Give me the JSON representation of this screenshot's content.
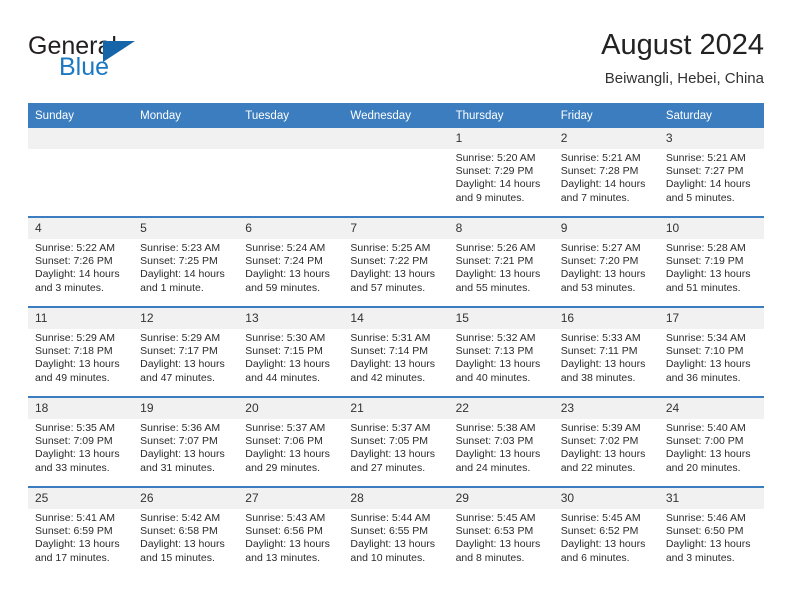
{
  "logo": {
    "word_one": "General",
    "word_two": "Blue",
    "triangle_color": "#1565a8",
    "blue_color": "#1c78c0"
  },
  "header": {
    "title": "August 2024",
    "subtitle": "Beiwangli, Hebei, China"
  },
  "theme": {
    "header_row_bg": "#3b7dbf",
    "date_band_bg": "#f1f1f1",
    "grid_line": "#3b7dbf"
  },
  "weekdays": [
    "Sunday",
    "Monday",
    "Tuesday",
    "Wednesday",
    "Thursday",
    "Friday",
    "Saturday"
  ],
  "weeks": [
    [
      {
        "day": "",
        "empty": true
      },
      {
        "day": "",
        "empty": true
      },
      {
        "day": "",
        "empty": true
      },
      {
        "day": "",
        "empty": true
      },
      {
        "day": "1",
        "sunrise": "Sunrise: 5:20 AM",
        "sunset": "Sunset: 7:29 PM",
        "daylight": "Daylight: 14 hours and 9 minutes."
      },
      {
        "day": "2",
        "sunrise": "Sunrise: 5:21 AM",
        "sunset": "Sunset: 7:28 PM",
        "daylight": "Daylight: 14 hours and 7 minutes."
      },
      {
        "day": "3",
        "sunrise": "Sunrise: 5:21 AM",
        "sunset": "Sunset: 7:27 PM",
        "daylight": "Daylight: 14 hours and 5 minutes."
      }
    ],
    [
      {
        "day": "4",
        "sunrise": "Sunrise: 5:22 AM",
        "sunset": "Sunset: 7:26 PM",
        "daylight": "Daylight: 14 hours and 3 minutes."
      },
      {
        "day": "5",
        "sunrise": "Sunrise: 5:23 AM",
        "sunset": "Sunset: 7:25 PM",
        "daylight": "Daylight: 14 hours and 1 minute."
      },
      {
        "day": "6",
        "sunrise": "Sunrise: 5:24 AM",
        "sunset": "Sunset: 7:24 PM",
        "daylight": "Daylight: 13 hours and 59 minutes."
      },
      {
        "day": "7",
        "sunrise": "Sunrise: 5:25 AM",
        "sunset": "Sunset: 7:22 PM",
        "daylight": "Daylight: 13 hours and 57 minutes."
      },
      {
        "day": "8",
        "sunrise": "Sunrise: 5:26 AM",
        "sunset": "Sunset: 7:21 PM",
        "daylight": "Daylight: 13 hours and 55 minutes."
      },
      {
        "day": "9",
        "sunrise": "Sunrise: 5:27 AM",
        "sunset": "Sunset: 7:20 PM",
        "daylight": "Daylight: 13 hours and 53 minutes."
      },
      {
        "day": "10",
        "sunrise": "Sunrise: 5:28 AM",
        "sunset": "Sunset: 7:19 PM",
        "daylight": "Daylight: 13 hours and 51 minutes."
      }
    ],
    [
      {
        "day": "11",
        "sunrise": "Sunrise: 5:29 AM",
        "sunset": "Sunset: 7:18 PM",
        "daylight": "Daylight: 13 hours and 49 minutes."
      },
      {
        "day": "12",
        "sunrise": "Sunrise: 5:29 AM",
        "sunset": "Sunset: 7:17 PM",
        "daylight": "Daylight: 13 hours and 47 minutes."
      },
      {
        "day": "13",
        "sunrise": "Sunrise: 5:30 AM",
        "sunset": "Sunset: 7:15 PM",
        "daylight": "Daylight: 13 hours and 44 minutes."
      },
      {
        "day": "14",
        "sunrise": "Sunrise: 5:31 AM",
        "sunset": "Sunset: 7:14 PM",
        "daylight": "Daylight: 13 hours and 42 minutes."
      },
      {
        "day": "15",
        "sunrise": "Sunrise: 5:32 AM",
        "sunset": "Sunset: 7:13 PM",
        "daylight": "Daylight: 13 hours and 40 minutes."
      },
      {
        "day": "16",
        "sunrise": "Sunrise: 5:33 AM",
        "sunset": "Sunset: 7:11 PM",
        "daylight": "Daylight: 13 hours and 38 minutes."
      },
      {
        "day": "17",
        "sunrise": "Sunrise: 5:34 AM",
        "sunset": "Sunset: 7:10 PM",
        "daylight": "Daylight: 13 hours and 36 minutes."
      }
    ],
    [
      {
        "day": "18",
        "sunrise": "Sunrise: 5:35 AM",
        "sunset": "Sunset: 7:09 PM",
        "daylight": "Daylight: 13 hours and 33 minutes."
      },
      {
        "day": "19",
        "sunrise": "Sunrise: 5:36 AM",
        "sunset": "Sunset: 7:07 PM",
        "daylight": "Daylight: 13 hours and 31 minutes."
      },
      {
        "day": "20",
        "sunrise": "Sunrise: 5:37 AM",
        "sunset": "Sunset: 7:06 PM",
        "daylight": "Daylight: 13 hours and 29 minutes."
      },
      {
        "day": "21",
        "sunrise": "Sunrise: 5:37 AM",
        "sunset": "Sunset: 7:05 PM",
        "daylight": "Daylight: 13 hours and 27 minutes."
      },
      {
        "day": "22",
        "sunrise": "Sunrise: 5:38 AM",
        "sunset": "Sunset: 7:03 PM",
        "daylight": "Daylight: 13 hours and 24 minutes."
      },
      {
        "day": "23",
        "sunrise": "Sunrise: 5:39 AM",
        "sunset": "Sunset: 7:02 PM",
        "daylight": "Daylight: 13 hours and 22 minutes."
      },
      {
        "day": "24",
        "sunrise": "Sunrise: 5:40 AM",
        "sunset": "Sunset: 7:00 PM",
        "daylight": "Daylight: 13 hours and 20 minutes."
      }
    ],
    [
      {
        "day": "25",
        "sunrise": "Sunrise: 5:41 AM",
        "sunset": "Sunset: 6:59 PM",
        "daylight": "Daylight: 13 hours and 17 minutes."
      },
      {
        "day": "26",
        "sunrise": "Sunrise: 5:42 AM",
        "sunset": "Sunset: 6:58 PM",
        "daylight": "Daylight: 13 hours and 15 minutes."
      },
      {
        "day": "27",
        "sunrise": "Sunrise: 5:43 AM",
        "sunset": "Sunset: 6:56 PM",
        "daylight": "Daylight: 13 hours and 13 minutes."
      },
      {
        "day": "28",
        "sunrise": "Sunrise: 5:44 AM",
        "sunset": "Sunset: 6:55 PM",
        "daylight": "Daylight: 13 hours and 10 minutes."
      },
      {
        "day": "29",
        "sunrise": "Sunrise: 5:45 AM",
        "sunset": "Sunset: 6:53 PM",
        "daylight": "Daylight: 13 hours and 8 minutes."
      },
      {
        "day": "30",
        "sunrise": "Sunrise: 5:45 AM",
        "sunset": "Sunset: 6:52 PM",
        "daylight": "Daylight: 13 hours and 6 minutes."
      },
      {
        "day": "31",
        "sunrise": "Sunrise: 5:46 AM",
        "sunset": "Sunset: 6:50 PM",
        "daylight": "Daylight: 13 hours and 3 minutes."
      }
    ]
  ]
}
